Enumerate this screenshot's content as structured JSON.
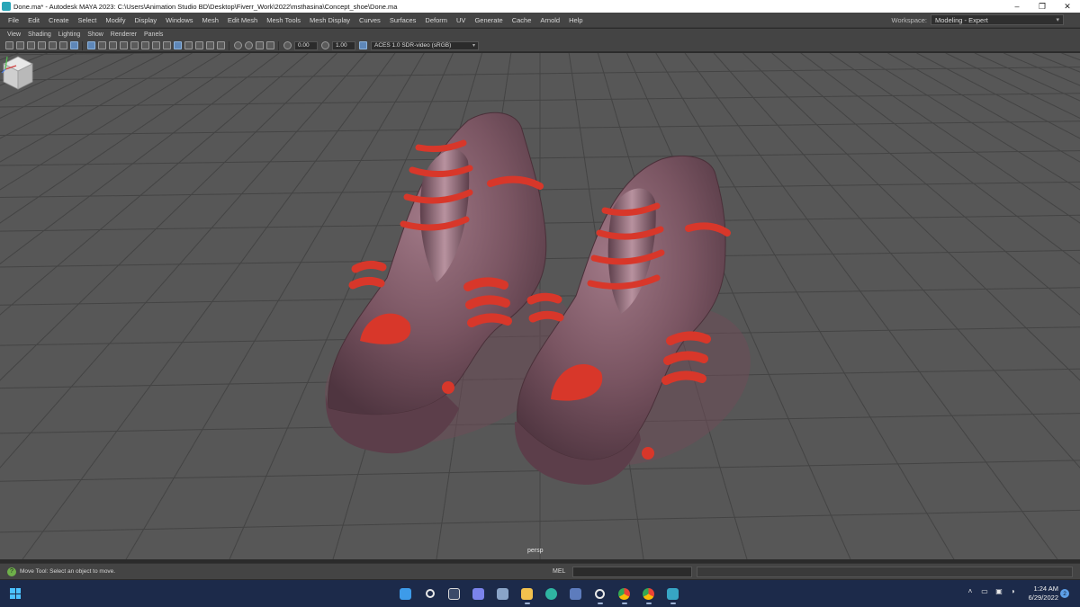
{
  "window": {
    "title": "Done.ma* - Autodesk MAYA 2023: C:\\Users\\Animation Studio BD\\Desktop\\Fiverr_Work\\2022\\msthasina\\Concept_shoe\\Done.ma",
    "minimize": "–",
    "maximize": "❐",
    "close": "✕"
  },
  "menubar": {
    "items": [
      "File",
      "Edit",
      "Create",
      "Select",
      "Modify",
      "Display",
      "Windows",
      "Mesh",
      "Edit Mesh",
      "Mesh Tools",
      "Mesh Display",
      "Curves",
      "Surfaces",
      "Deform",
      "UV",
      "Generate",
      "Cache",
      "Arnold",
      "Help"
    ],
    "workspace_label": "Workspace:",
    "workspace_value": "Modeling - Expert"
  },
  "panel_menu": {
    "items": [
      "View",
      "Shading",
      "Lighting",
      "Show",
      "Renderer",
      "Panels"
    ]
  },
  "panel_toolbar": {
    "exposure": "0.00",
    "gamma": "1.00",
    "color_transform": "ACES 1.0 SDR-video (sRGB)"
  },
  "viewport": {
    "camera_label": "persp",
    "grid_color": "#444444",
    "background_color": "#575757",
    "shoe_color": "#7a5562",
    "accent_color": "#d8372a"
  },
  "helpline": {
    "text": "Move Tool: Select an object to move.",
    "mel_label": "MEL"
  },
  "taskbar": {
    "time": "1:24 AM",
    "date": "6/29/2022",
    "notification_count": "2",
    "apps": [
      "start-icon",
      "search-icon",
      "file-explorer-icon",
      "teams-icon",
      "photos-icon",
      "folder-icon",
      "edge-icon",
      "store-icon",
      "settings-icon",
      "chrome-icon",
      "chrome-profile-icon",
      "maya-icon"
    ]
  }
}
